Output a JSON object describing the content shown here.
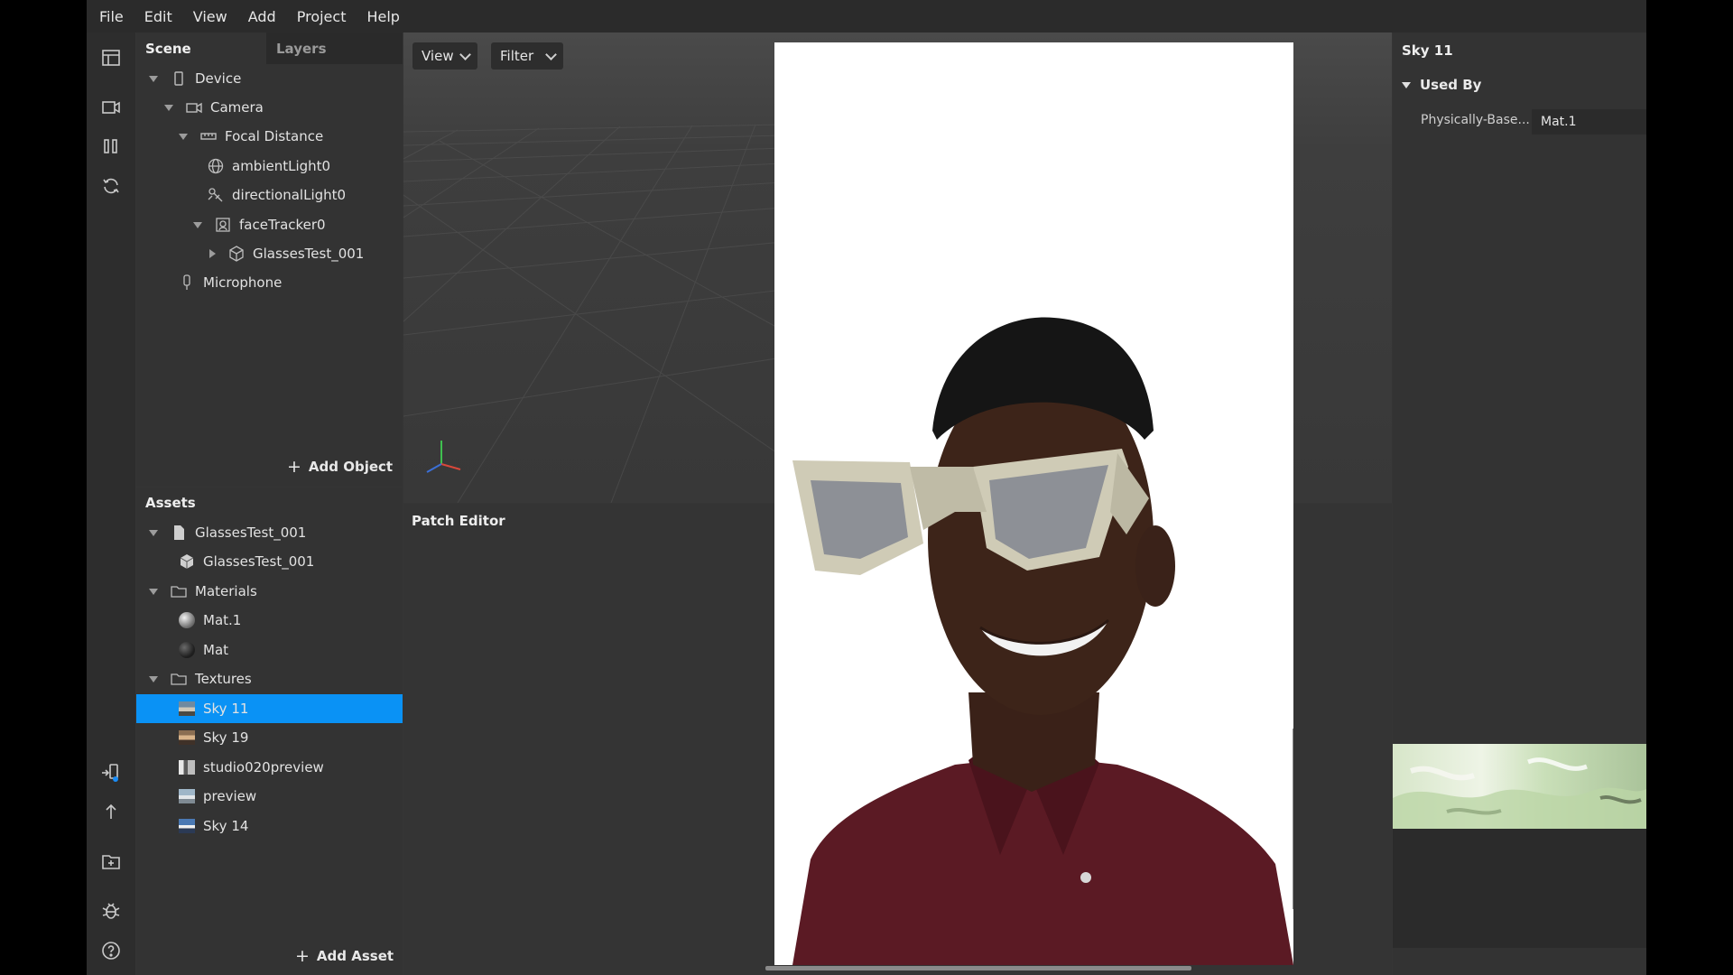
{
  "menu": [
    "File",
    "Edit",
    "View",
    "Add",
    "Project",
    "Help"
  ],
  "scene": {
    "tabs": {
      "scene": "Scene",
      "layers": "Layers"
    },
    "items": [
      {
        "label": "Device"
      },
      {
        "label": "Camera"
      },
      {
        "label": "Focal Distance"
      },
      {
        "label": "ambientLight0"
      },
      {
        "label": "directionalLight0"
      },
      {
        "label": "faceTracker0"
      },
      {
        "label": "GlassesTest_001"
      },
      {
        "label": "Microphone"
      }
    ],
    "add_object": "Add Object"
  },
  "assets": {
    "title": "Assets",
    "items": [
      {
        "label": "GlassesTest_001"
      },
      {
        "label": "GlassesTest_001"
      },
      {
        "label": "Materials"
      },
      {
        "label": "Mat.1"
      },
      {
        "label": "Mat"
      },
      {
        "label": "Textures"
      },
      {
        "label": "Sky 11"
      },
      {
        "label": "Sky 19"
      },
      {
        "label": "studio020preview"
      },
      {
        "label": "preview"
      },
      {
        "label": "Sky 14"
      }
    ],
    "add_asset": "Add Asset"
  },
  "viewport": {
    "view": "View",
    "filter": "Filter"
  },
  "patch_editor": {
    "title": "Patch Editor"
  },
  "inspector": {
    "title": "Sky 11",
    "section": "Used By",
    "prop_label": "Physically-Base...",
    "prop_value": "Mat.1"
  },
  "colors": {
    "accent": "#0a92f5",
    "shirt": "#5b1a24",
    "glasses_frame": "#d8d4bf"
  }
}
